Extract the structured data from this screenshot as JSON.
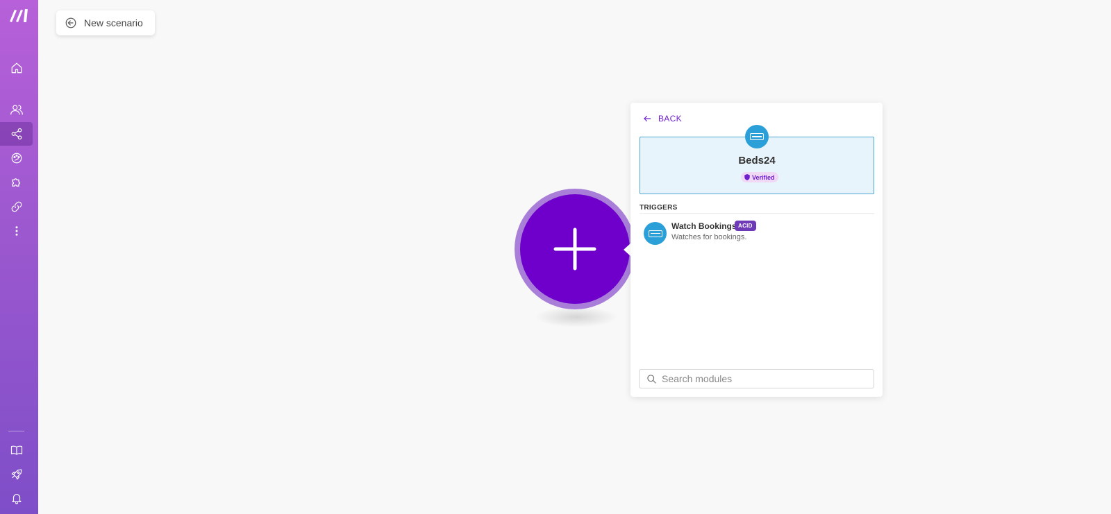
{
  "window": {
    "title": "New scenario"
  },
  "sidebar": {
    "items": [
      {
        "name": "home",
        "icon": "home-icon"
      },
      {
        "name": "team",
        "icon": "users-icon"
      },
      {
        "name": "scenarios",
        "icon": "share-nodes-icon",
        "active": true
      },
      {
        "name": "templates",
        "icon": "palette-icon"
      },
      {
        "name": "apps",
        "icon": "puzzle-icon"
      },
      {
        "name": "connections",
        "icon": "link-icon"
      },
      {
        "name": "more",
        "icon": "more-vertical-icon"
      },
      {
        "name": "help",
        "icon": "book-icon"
      },
      {
        "name": "whats-new",
        "icon": "rocket-icon"
      },
      {
        "name": "notifications",
        "icon": "bell-icon"
      }
    ]
  },
  "toolbar": {
    "back_label": "New scenario"
  },
  "panel": {
    "back_label": "BACK",
    "app": {
      "name": "Beds24",
      "badge": "Verified",
      "color": "#2a9fd8"
    },
    "section": "TRIGGERS",
    "modules": [
      {
        "name": "Watch Bookings",
        "tag": "ACID",
        "description": "Watches for bookings."
      }
    ],
    "search": {
      "placeholder": "Search modules",
      "value": ""
    }
  },
  "colors": {
    "accent": "#6f00cc",
    "sidebar_top": "#b760d9",
    "sidebar_bottom": "#7e4ec8"
  }
}
